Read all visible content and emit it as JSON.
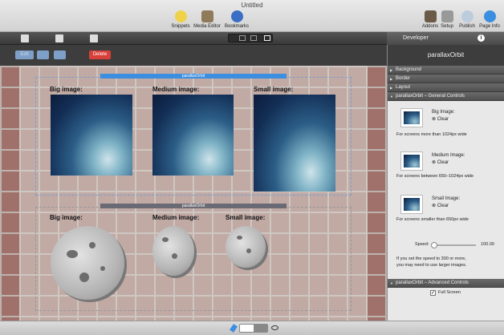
{
  "window": {
    "title": "Untitled"
  },
  "toolbar": {
    "items": [
      {
        "label": "Snippets",
        "icon": "snippets-icon"
      },
      {
        "label": "Media Editor",
        "icon": "media-editor-icon"
      },
      {
        "label": "Bookmarks",
        "icon": "bookmarks-icon"
      },
      {
        "label": "Addons",
        "icon": "addons-icon"
      },
      {
        "label": "Setup",
        "icon": "setup-icon"
      },
      {
        "label": "Publish",
        "icon": "publish-icon"
      },
      {
        "label": "Page Info",
        "icon": "page-info-icon"
      }
    ]
  },
  "developer": {
    "title": "Developer",
    "info": "i"
  },
  "actions": {
    "edit": "Edit",
    "delete": "Delete"
  },
  "canvas": {
    "section1": {
      "tag": "parallaxOrbit",
      "labels": [
        "Big image:",
        "Medium image:",
        "Small image:"
      ]
    },
    "section2": {
      "tag": "parallaxOrbit",
      "labels": [
        "Big image:",
        "Medium image:",
        "Small image:"
      ]
    }
  },
  "inspector": {
    "title": "parallaxOrbit",
    "sections": [
      "Background",
      "Border",
      "Layout"
    ],
    "general": "parallaxOrbit – General Controls",
    "big": {
      "label": "Big Image:",
      "clear": "Clear",
      "caption": "For screens more than 1024px wide"
    },
    "medium": {
      "label": "Medium Image:",
      "clear": "Clear",
      "caption": "For screens between 650–1024px wide"
    },
    "small": {
      "label": "Small Image:",
      "clear": "Clear",
      "caption": "For screens smaller than 650px wide"
    },
    "speed": {
      "label": "Speed:",
      "value": "100.00"
    },
    "speed_note1": "If you set the speed to 300 or more,",
    "speed_note2": "you may need to use larger images.",
    "advanced": "parallaxOrbit – Advanced Controls",
    "fullscreen": "Full Screen"
  },
  "colors": {
    "accent": "#3b8ee0",
    "delete": "#d9403a"
  }
}
